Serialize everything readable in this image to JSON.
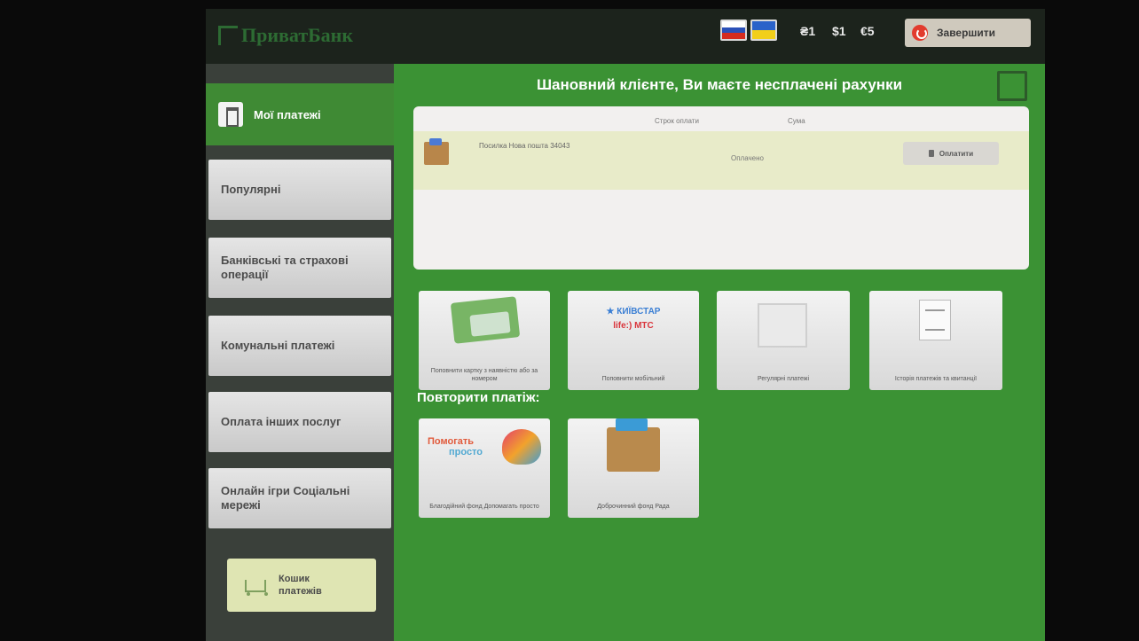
{
  "header": {
    "logo_text": "ПриватБанк",
    "currencies": [
      "₴1",
      "$1",
      "€5"
    ],
    "finish_label": "Завершити"
  },
  "sidebar": {
    "my_payments_label": "Мої платежі",
    "items": [
      {
        "label": "Популярні"
      },
      {
        "label": "Банківські та страхові операції"
      },
      {
        "label": "Комунальні платежі"
      },
      {
        "label": "Оплата інших послуг"
      },
      {
        "label": "Онлайн ігри Соціальні мережі"
      }
    ],
    "cart_label": "Кошик платежів"
  },
  "main": {
    "heading": "Шановний клієнте, Ви маєте несплачені рахунки",
    "table": {
      "columns": [
        "Строк оплати",
        "Сума"
      ],
      "rows": [
        {
          "name": "Посилка Нова пошта 34043",
          "status": "Оплачено",
          "action": "Оплатити"
        }
      ]
    },
    "tiles": [
      {
        "label": "Поповнити картку з наявністю або за номером",
        "icon": "card-icon"
      },
      {
        "label": "Поповнити мобільний",
        "icon": "mobile-operators-icon",
        "logos": [
          "★ КИЇВСТАР",
          "life:)  МТС"
        ]
      },
      {
        "label": "Регулярні платежі",
        "icon": "calendar-icon"
      },
      {
        "label": "Історія платежів та квитанції",
        "icon": "document-icon"
      }
    ],
    "repeat_heading": "Повторити платіж:",
    "repeat_tiles": [
      {
        "label": "Благодійний фонд Допомагать просто",
        "icon": "charity-heart-icon",
        "logo_line1": "Помогать",
        "logo_line2": "просто"
      },
      {
        "label": "Доброчинний фонд Рада",
        "icon": "parcel-box-icon"
      }
    ]
  },
  "colors": {
    "main_green": "#3b9234",
    "sidebar_active": "#3f8a34",
    "dark_bar": "#1c231c",
    "finish_icon": "#e23b2e"
  }
}
